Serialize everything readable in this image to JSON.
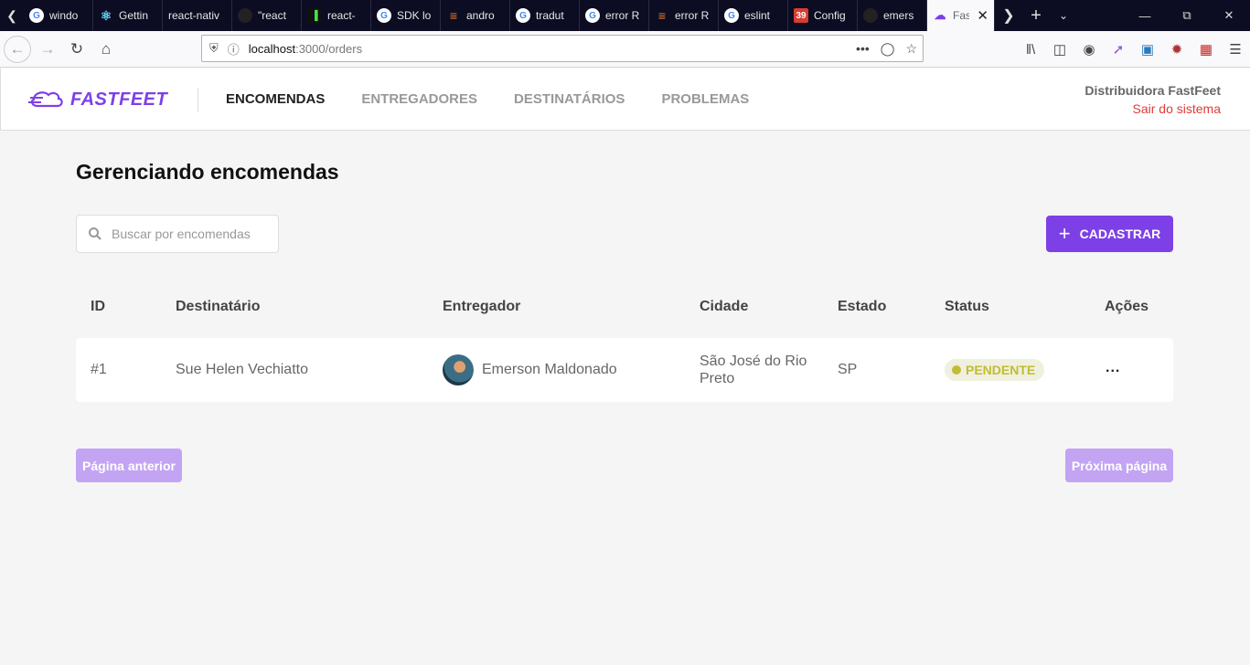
{
  "browser": {
    "tabs": [
      {
        "title": "windo",
        "icon": "google-icon",
        "color": "#ffffff"
      },
      {
        "title": "Gettin",
        "icon": "react-icon",
        "color": "#61dafb"
      },
      {
        "title": "react-nativ",
        "icon": "",
        "color": ""
      },
      {
        "title": "\"react",
        "icon": "github-icon",
        "color": "#333333"
      },
      {
        "title": "react-",
        "icon": "ds-icon",
        "color": "#2b2b2b"
      },
      {
        "title": "SDK lo",
        "icon": "google-icon",
        "color": "#ffffff"
      },
      {
        "title": "andro",
        "icon": "stackoverflow-icon",
        "color": "#f48024"
      },
      {
        "title": "tradut",
        "icon": "google-icon",
        "color": "#ffffff"
      },
      {
        "title": "error R",
        "icon": "google-icon",
        "color": "#ffffff"
      },
      {
        "title": "error R",
        "icon": "stackoverflow-icon",
        "color": "#f48024"
      },
      {
        "title": "eslint",
        "icon": "google-icon",
        "color": "#ffffff"
      },
      {
        "title": "Config",
        "icon": "badge-39-icon",
        "color": "#d83b2f",
        "badge": "39"
      },
      {
        "title": "emers",
        "icon": "github-icon",
        "color": "#333333"
      },
      {
        "title": "Fas",
        "icon": "fastfeet-icon",
        "color": "#7d40e7",
        "active": true
      }
    ],
    "url_host": "localhost",
    "url_path": ":3000/orders"
  },
  "app": {
    "logo_text": "FASTFEET",
    "accent_color": "#7d40e7",
    "nav": [
      "ENCOMENDAS",
      "ENTREGADORES",
      "DESTINATÁRIOS",
      "PROBLEMAS"
    ],
    "active_nav": "ENCOMENDAS",
    "user_name": "Distribuidora FastFeet",
    "logout_label": "Sair do sistema"
  },
  "main": {
    "title": "Gerenciando encomendas",
    "search_placeholder": "Buscar por encomendas",
    "search_value": "",
    "add_button": "CADASTRAR",
    "columns": [
      "ID",
      "Destinatário",
      "Entregador",
      "Cidade",
      "Estado",
      "Status",
      "Ações"
    ],
    "rows": [
      {
        "id": "#1",
        "recipient": "Sue Helen Vechiatto",
        "deliveryman": "Emerson Maldonado",
        "city_line1": "São José do Rio",
        "city_line2": "Preto",
        "state": "SP",
        "status": "PENDENTE",
        "status_color": "#c1bc35",
        "actions": "..."
      }
    ],
    "prev_button": "Página anterior",
    "next_button": "Próxima página"
  }
}
